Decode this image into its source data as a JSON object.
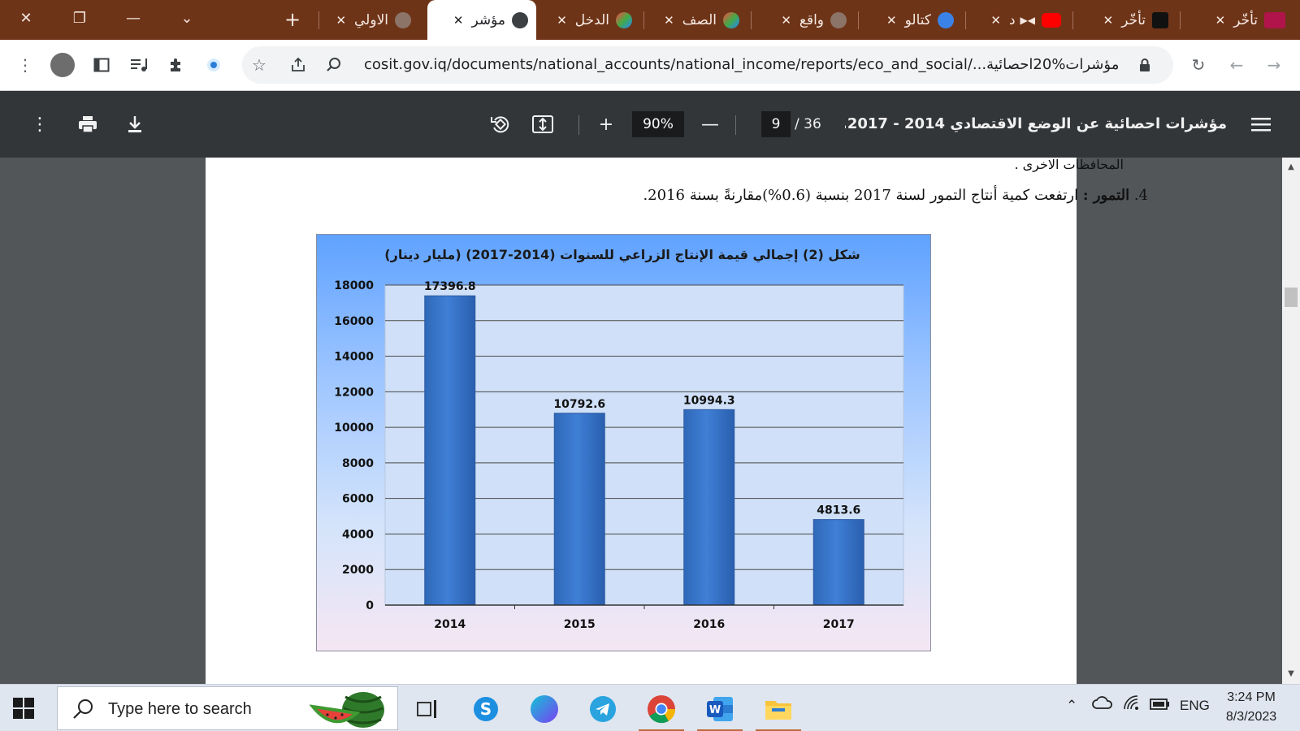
{
  "browser": {
    "tabs": [
      {
        "title": "الاولي",
        "close": "✕"
      },
      {
        "title": "مؤشر",
        "close": "✕"
      },
      {
        "title": "الدخل",
        "close": "✕"
      },
      {
        "title": "الصف",
        "close": "✕"
      },
      {
        "title": "واقع",
        "close": "✕"
      },
      {
        "title": "كتالو",
        "close": "✕"
      },
      {
        "title": "د",
        "close": "✕"
      },
      {
        "title": "تأخّر",
        "close": "✕"
      },
      {
        "title": "تأخّر",
        "close": "✕"
      }
    ],
    "url": "cosit.gov.iq/documents/national_accounts/national_income/reports/eco_and_social/...مؤشرات%20احصائية"
  },
  "pdf_toolbar": {
    "zoom": "90%",
    "page_current": "9",
    "page_total": "/ 36",
    "title": "مؤشرات احصائية عن الوضع الاقتصادي 2014 - 2017.f..."
  },
  "document": {
    "line1": "المحافظات الاخرى .",
    "item_number": "4.",
    "item_bold": "التمور :",
    "item_text": " ارتفعت كمية أنتاج التمور لسنة 2017 بنسبة (0.6%)مقارنةً بسنة 2016."
  },
  "chart_data": {
    "type": "bar",
    "title": "شكل (2) إجمالي قيمة الإنتاج الزراعي للسنوات (2014-2017) (مليار دينار)",
    "categories": [
      "2014",
      "2015",
      "2016",
      "2017"
    ],
    "values": [
      17396.8,
      10792.6,
      10994.3,
      4813.6
    ],
    "data_labels": [
      "17396.8",
      "10792.6",
      "10994.3",
      "4813.6"
    ],
    "yticks": [
      "0",
      "2000",
      "4000",
      "6000",
      "8000",
      "10000",
      "12000",
      "14000",
      "16000",
      "18000"
    ],
    "ylim": [
      0,
      18000
    ],
    "grid": true,
    "bar_color": "#3f7fd6"
  },
  "taskbar": {
    "search_placeholder": "Type here to search",
    "lang": "ENG",
    "time": "3:24 PM",
    "date": "8/3/2023"
  }
}
